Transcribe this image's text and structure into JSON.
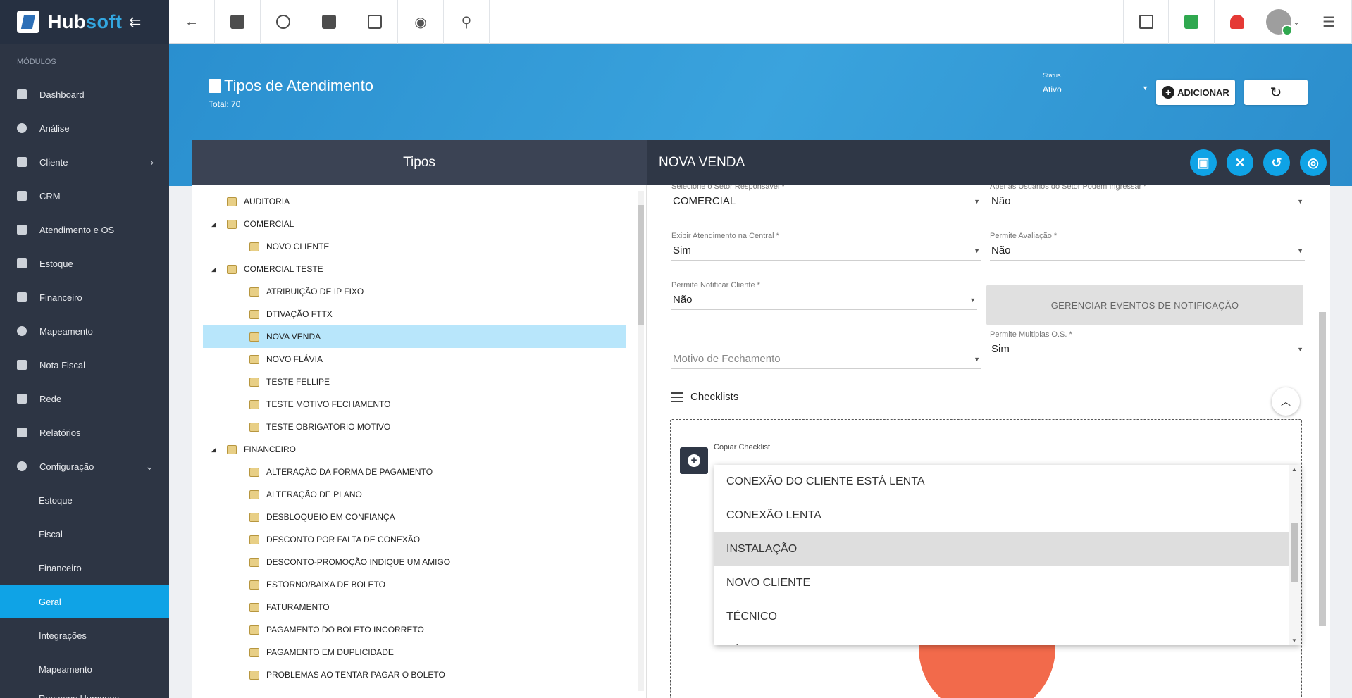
{
  "brand": {
    "name_part1": "Hub",
    "name_part2": "soft"
  },
  "sidebar": {
    "section": "MÓDULOS",
    "items": [
      {
        "label": "Dashboard"
      },
      {
        "label": "Análise"
      },
      {
        "label": "Cliente"
      },
      {
        "label": "CRM"
      },
      {
        "label": "Atendimento e OS"
      },
      {
        "label": "Estoque"
      },
      {
        "label": "Financeiro"
      },
      {
        "label": "Mapeamento"
      },
      {
        "label": "Nota Fiscal"
      },
      {
        "label": "Rede"
      },
      {
        "label": "Relatórios"
      },
      {
        "label": "Configuração"
      }
    ],
    "sub_items": [
      {
        "label": "Estoque"
      },
      {
        "label": "Fiscal"
      },
      {
        "label": "Financeiro"
      },
      {
        "label": "Geral"
      },
      {
        "label": "Integrações"
      },
      {
        "label": "Mapeamento"
      },
      {
        "label": "Recursos Humanos"
      }
    ]
  },
  "header": {
    "title": "Tipos de Atendimento",
    "total": "Total: 70",
    "status_label": "Status",
    "status_value": "Ativo",
    "add_label": "ADICIONAR"
  },
  "left_panel": {
    "title": "Tipos"
  },
  "tree": [
    {
      "label": "AUDITORIA"
    },
    {
      "label": "COMERCIAL"
    },
    {
      "label": "NOVO CLIENTE"
    },
    {
      "label": "COMERCIAL TESTE"
    },
    {
      "label": "ATRIBUIÇÃO DE IP FIXO"
    },
    {
      "label": "DTIVAÇÃO FTTX"
    },
    {
      "label": "NOVA VENDA"
    },
    {
      "label": "NOVO FLÁVIA"
    },
    {
      "label": "TESTE FELLIPE"
    },
    {
      "label": "TESTE MOTIVO FECHAMENTO"
    },
    {
      "label": "TESTE OBRIGATORIO MOTIVO"
    },
    {
      "label": "FINANCEIRO"
    },
    {
      "label": "ALTERAÇÃO DA FORMA DE PAGAMENTO"
    },
    {
      "label": "ALTERAÇÃO DE PLANO"
    },
    {
      "label": "DESBLOQUEIO EM CONFIANÇA"
    },
    {
      "label": "DESCONTO POR FALTA DE CONEXÃO"
    },
    {
      "label": "DESCONTO-PROMOÇÃO INDIQUE UM AMIGO"
    },
    {
      "label": "ESTORNO/BAIXA DE BOLETO"
    },
    {
      "label": "FATURAMENTO"
    },
    {
      "label": "PAGAMENTO DO BOLETO INCORRETO"
    },
    {
      "label": "PAGAMENTO EM DUPLICIDADE"
    },
    {
      "label": "PROBLEMAS AO TENTAR PAGAR O BOLETO"
    }
  ],
  "right_panel": {
    "title": "NOVA VENDA"
  },
  "form": {
    "setor_label": "Selecione o Setor Responsável *",
    "setor_value": "COMERCIAL",
    "apenas_label": "Apenas Usuários do Setor Podem Ingressar *",
    "apenas_value": "Não",
    "exibir_label": "Exibir Atendimento na Central *",
    "exibir_value": "Sim",
    "avaliacao_label": "Permite Avaliação *",
    "avaliacao_value": "Não",
    "notificar_label": "Permite Notificar Cliente *",
    "notificar_value": "Não",
    "gerenciar_label": "GERENCIAR EVENTOS DE NOTIFICAÇÃO",
    "motivo_placeholder": "Motivo de Fechamento",
    "multiplas_label": "Permite Multiplas O.S. *",
    "multiplas_value": "Sim"
  },
  "checklists": {
    "title": "Checklists",
    "copy_label": "Copiar Checklist",
    "options": [
      {
        "label": "CONEXÃO DO CLIENTE ESTÁ LENTA"
      },
      {
        "label": "CONEXÃO LENTA"
      },
      {
        "label": "INSTALAÇÃO"
      },
      {
        "label": "NOVO CLIENTE"
      },
      {
        "label": "TÉCNICO"
      },
      {
        "label": "TÉCNICO"
      }
    ]
  }
}
